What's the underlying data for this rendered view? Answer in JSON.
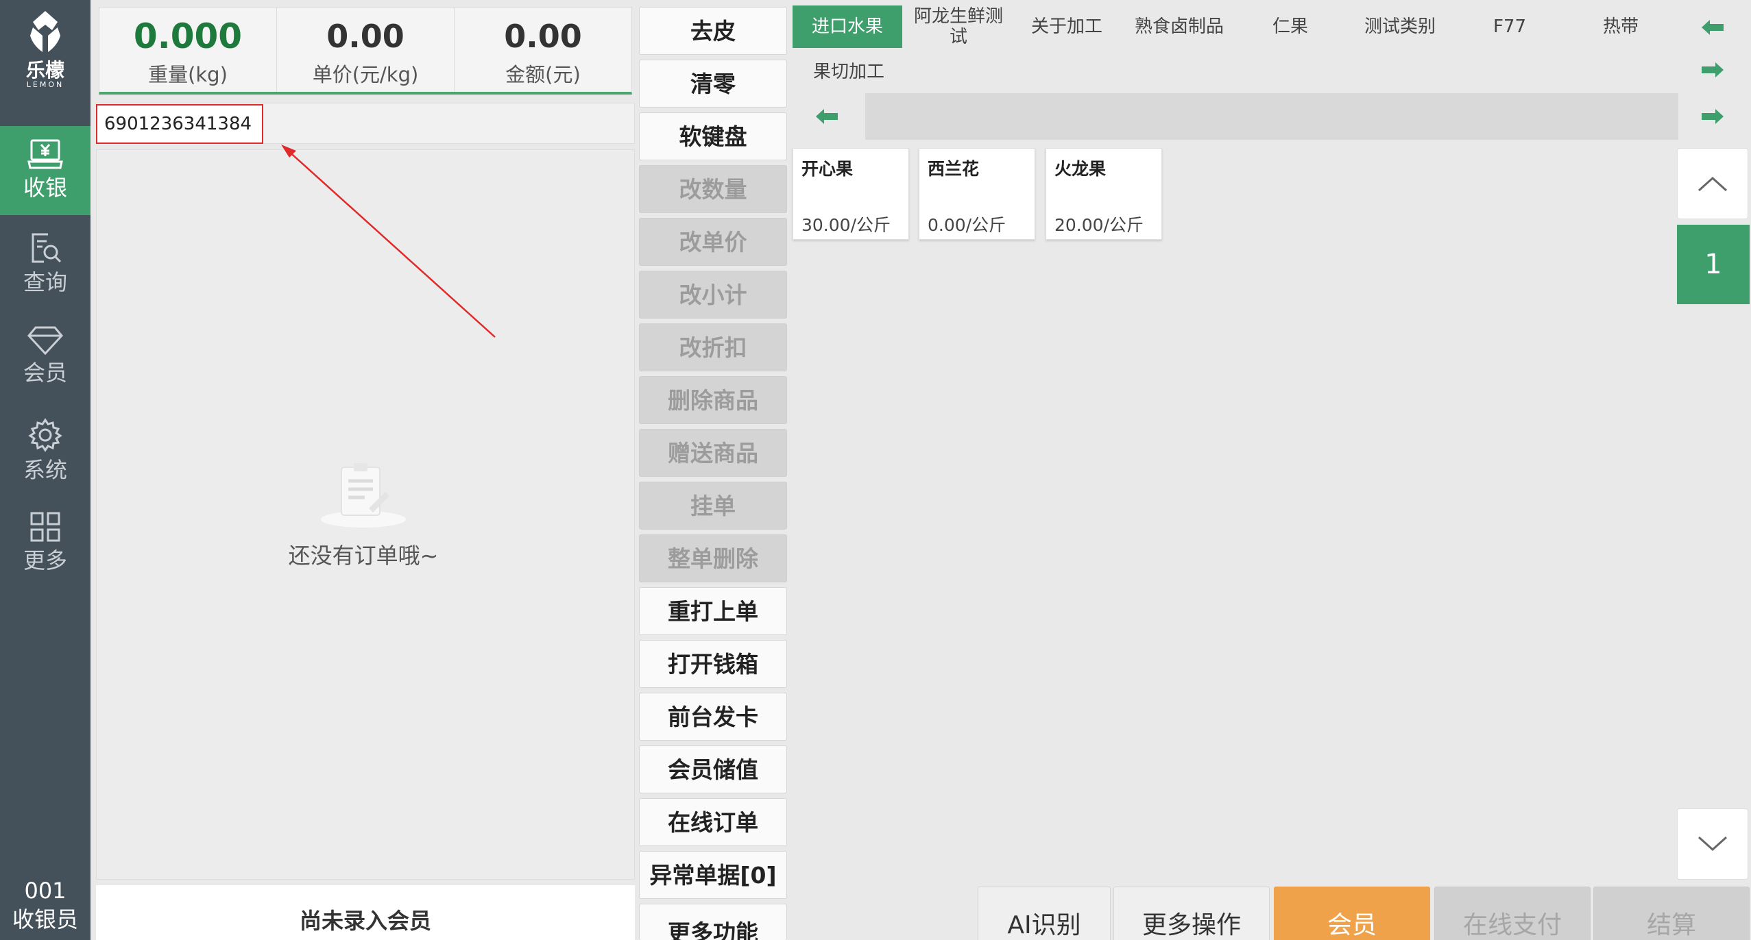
{
  "sidebar": {
    "logo_cn": "乐檬",
    "logo_en": "LEMON",
    "items": [
      {
        "label": "收银",
        "icon": "cash-register-icon",
        "active": true
      },
      {
        "label": "查询",
        "icon": "search-document-icon"
      },
      {
        "label": "会员",
        "icon": "diamond-icon"
      },
      {
        "label": "系统",
        "icon": "gear-icon"
      },
      {
        "label": "更多",
        "icon": "grid-icon"
      }
    ],
    "cashier_id": "001",
    "cashier_label": "收银员"
  },
  "scale": {
    "weight_value": "0.000",
    "weight_label": "重量(kg)",
    "unit_price_value": "0.00",
    "unit_price_label": "单价(元/kg)",
    "amount_value": "0.00",
    "amount_label": "金额(元)"
  },
  "barcode": {
    "value": "6901236341384"
  },
  "order": {
    "empty_text": "还没有订单哦~"
  },
  "member_status": "尚未录入会员",
  "functions": [
    {
      "label": "去皮",
      "enabled": true
    },
    {
      "label": "清零",
      "enabled": true
    },
    {
      "label": "软键盘",
      "enabled": true
    },
    {
      "label": "改数量",
      "enabled": false
    },
    {
      "label": "改单价",
      "enabled": false
    },
    {
      "label": "改小计",
      "enabled": false
    },
    {
      "label": "改折扣",
      "enabled": false
    },
    {
      "label": "删除商品",
      "enabled": false
    },
    {
      "label": "赠送商品",
      "enabled": false
    },
    {
      "label": "挂单",
      "enabled": false
    },
    {
      "label": "整单删除",
      "enabled": false
    },
    {
      "label": "重打上单",
      "enabled": true
    },
    {
      "label": "打开钱箱",
      "enabled": true
    },
    {
      "label": "前台发卡",
      "enabled": true
    },
    {
      "label": "会员储值",
      "enabled": true
    },
    {
      "label": "在线订单",
      "enabled": true
    },
    {
      "label": "异常单据[0]",
      "enabled": true
    },
    {
      "label": "更多功能",
      "enabled": true
    }
  ],
  "categories": [
    {
      "label": "进口水果",
      "active": true
    },
    {
      "label": "阿龙生鲜测试"
    },
    {
      "label": "关于加工"
    },
    {
      "label": "熟食卤制品"
    },
    {
      "label": "仁果"
    },
    {
      "label": "测试类别"
    },
    {
      "label": "F77"
    },
    {
      "label": "热带"
    }
  ],
  "sub_categories": [
    "果切加工"
  ],
  "products": [
    {
      "name": "开心果",
      "price": "30.00/公斤"
    },
    {
      "name": "西兰花",
      "price": "0.00/公斤"
    },
    {
      "name": "火龙果",
      "price": "20.00/公斤"
    }
  ],
  "pagination": {
    "current_page": "1"
  },
  "actions": [
    {
      "label": "AI识别",
      "style": "normal"
    },
    {
      "label": "更多操作",
      "style": "normal"
    },
    {
      "label": "会员",
      "style": "orange"
    },
    {
      "label": "在线支付",
      "style": "disabled"
    },
    {
      "label": "结算",
      "style": "disabled"
    }
  ],
  "colors": {
    "sidebar_bg": "#44505a",
    "accent_green": "#3e9e6c",
    "member_orange": "#f0a24a",
    "annotation_red": "#e02a2a"
  }
}
